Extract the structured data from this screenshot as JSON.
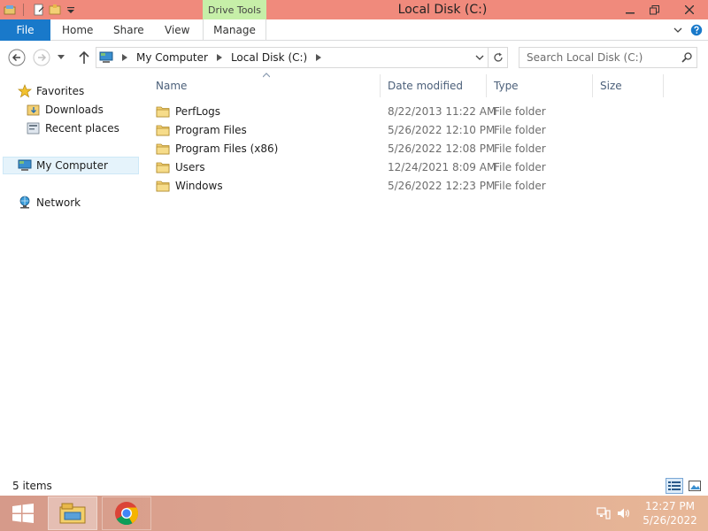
{
  "window": {
    "title": "Local Disk (C:)",
    "contextual_tab_group": "Drive Tools",
    "titlebar_color": "#f08a7c",
    "file_tab_color": "#1979ca"
  },
  "ribbon": {
    "tabs": {
      "file": "File",
      "home": "Home",
      "share": "Share",
      "view": "View",
      "manage": "Manage"
    }
  },
  "address": {
    "crumbs": [
      "My Computer",
      "Local Disk (C:)"
    ],
    "search_placeholder": "Search Local Disk (C:)"
  },
  "navigation": {
    "favorites": "Favorites",
    "downloads": "Downloads",
    "recent_places": "Recent places",
    "my_computer": "My Computer",
    "network": "Network"
  },
  "columns": {
    "name": "Name",
    "date_modified": "Date modified",
    "type": "Type",
    "size": "Size"
  },
  "files": [
    {
      "name": "PerfLogs",
      "date": "8/22/2013 11:22 AM",
      "type": "File folder"
    },
    {
      "name": "Program Files",
      "date": "5/26/2022 12:10 PM",
      "type": "File folder"
    },
    {
      "name": "Program Files (x86)",
      "date": "5/26/2022 12:08 PM",
      "type": "File folder"
    },
    {
      "name": "Users",
      "date": "12/24/2021 8:09 AM",
      "type": "File folder"
    },
    {
      "name": "Windows",
      "date": "5/26/2022 12:23 PM",
      "type": "File folder"
    }
  ],
  "status": {
    "item_count": "5 items"
  },
  "taskbar": {
    "time": "12:27 PM",
    "date": "5/26/2022"
  }
}
